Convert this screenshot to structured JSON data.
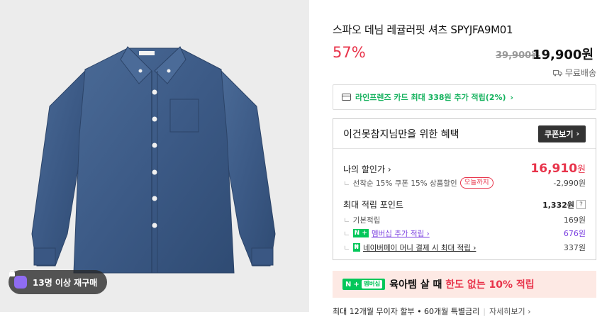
{
  "image": {
    "alt": "denim button-down shirt",
    "badge_text": "13명 이상 재구매",
    "badge_icon": "rebuy-bag-icon",
    "bg_color": "#ececec",
    "shirt_color": "#3c5a86"
  },
  "product": {
    "title": "스파오 데님 레귤러핏 셔츠 SPYJFA9M01",
    "discount": "57%",
    "original_price": "39,900원",
    "sale_price": "19,900원",
    "shipping": "무료배송",
    "shipping_icon": "truck-icon"
  },
  "card_promo": {
    "icon": "credit-card-icon",
    "text": "라인프렌즈 카드 최대 338원 추가 적립(2%)",
    "chevron": "›"
  },
  "benefits": {
    "title": "이건못참지님만을 위한 혜택",
    "coupon_button": "쿠폰보기",
    "coupon_chevron": "›",
    "my_discount_label": "나의 할인가 ›",
    "my_discount_value": "16,910",
    "my_discount_unit": "원",
    "coupon_detail": "선착순 15% 쿠폰 15% 상품할인",
    "coupon_pill": "오늘까지",
    "coupon_amount": "-2,990원",
    "max_points_label": "최대 적립 포인트",
    "max_points_value": "1,332원",
    "help": "?",
    "basic_label": "기본적립",
    "basic_value": "169원",
    "member_label": "멤버십 추가 적립 ›",
    "member_value": "676원",
    "npay_label": "네이버페이 머니 결제 시 최대 적립 ›",
    "npay_value": "337원",
    "member_badge": "N +",
    "npay_badge": "₦"
  },
  "naver_banner": {
    "badge_n": "N",
    "badge_plus": "+",
    "badge_membership": "멤버십",
    "text_pre": "육아템 살 때 ",
    "text_highlight": "한도 없는 10% 적립",
    "bg_color": "#fde9e4"
  },
  "installment": {
    "text": "최대 12개월 무이자 할부 • 60개월 특별금리",
    "more": "자세히보기 ›"
  }
}
